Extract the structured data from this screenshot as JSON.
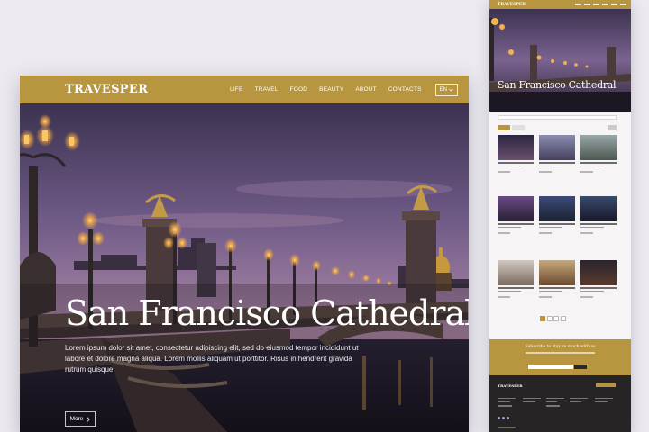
{
  "colors": {
    "background": "#eceaf0",
    "accent": "#b7963f",
    "footer": "#262425"
  },
  "header": {
    "logo": "TRAVESPER",
    "nav": [
      "LIFE",
      "TRAVEL",
      "FOOD",
      "BEAUTY",
      "ABOUT",
      "CONTACTS"
    ],
    "language": "EN",
    "language_icon": "chevron-down-icon"
  },
  "hero": {
    "title": "San Francisco Cathedral",
    "text": "Lorem ipsum dolor sit amet, consectetur adipiscing elit, sed do eiusmod tempor incididunt ut labore et dolore magna aliqua. Lorem mollis aliquam ut porttitor. Risus in hendrerit gravida rutrum quisque.",
    "button_label": "More",
    "button_icon": "chevron-right-icon"
  },
  "side_preview": {
    "logo": "TRAVESPER",
    "hero_title": "San Francisco Cathedral",
    "subscribe_title": "Subscribe to stay so much with us",
    "footer_logo": "TRAVESPER",
    "pagination_pages": 4
  }
}
